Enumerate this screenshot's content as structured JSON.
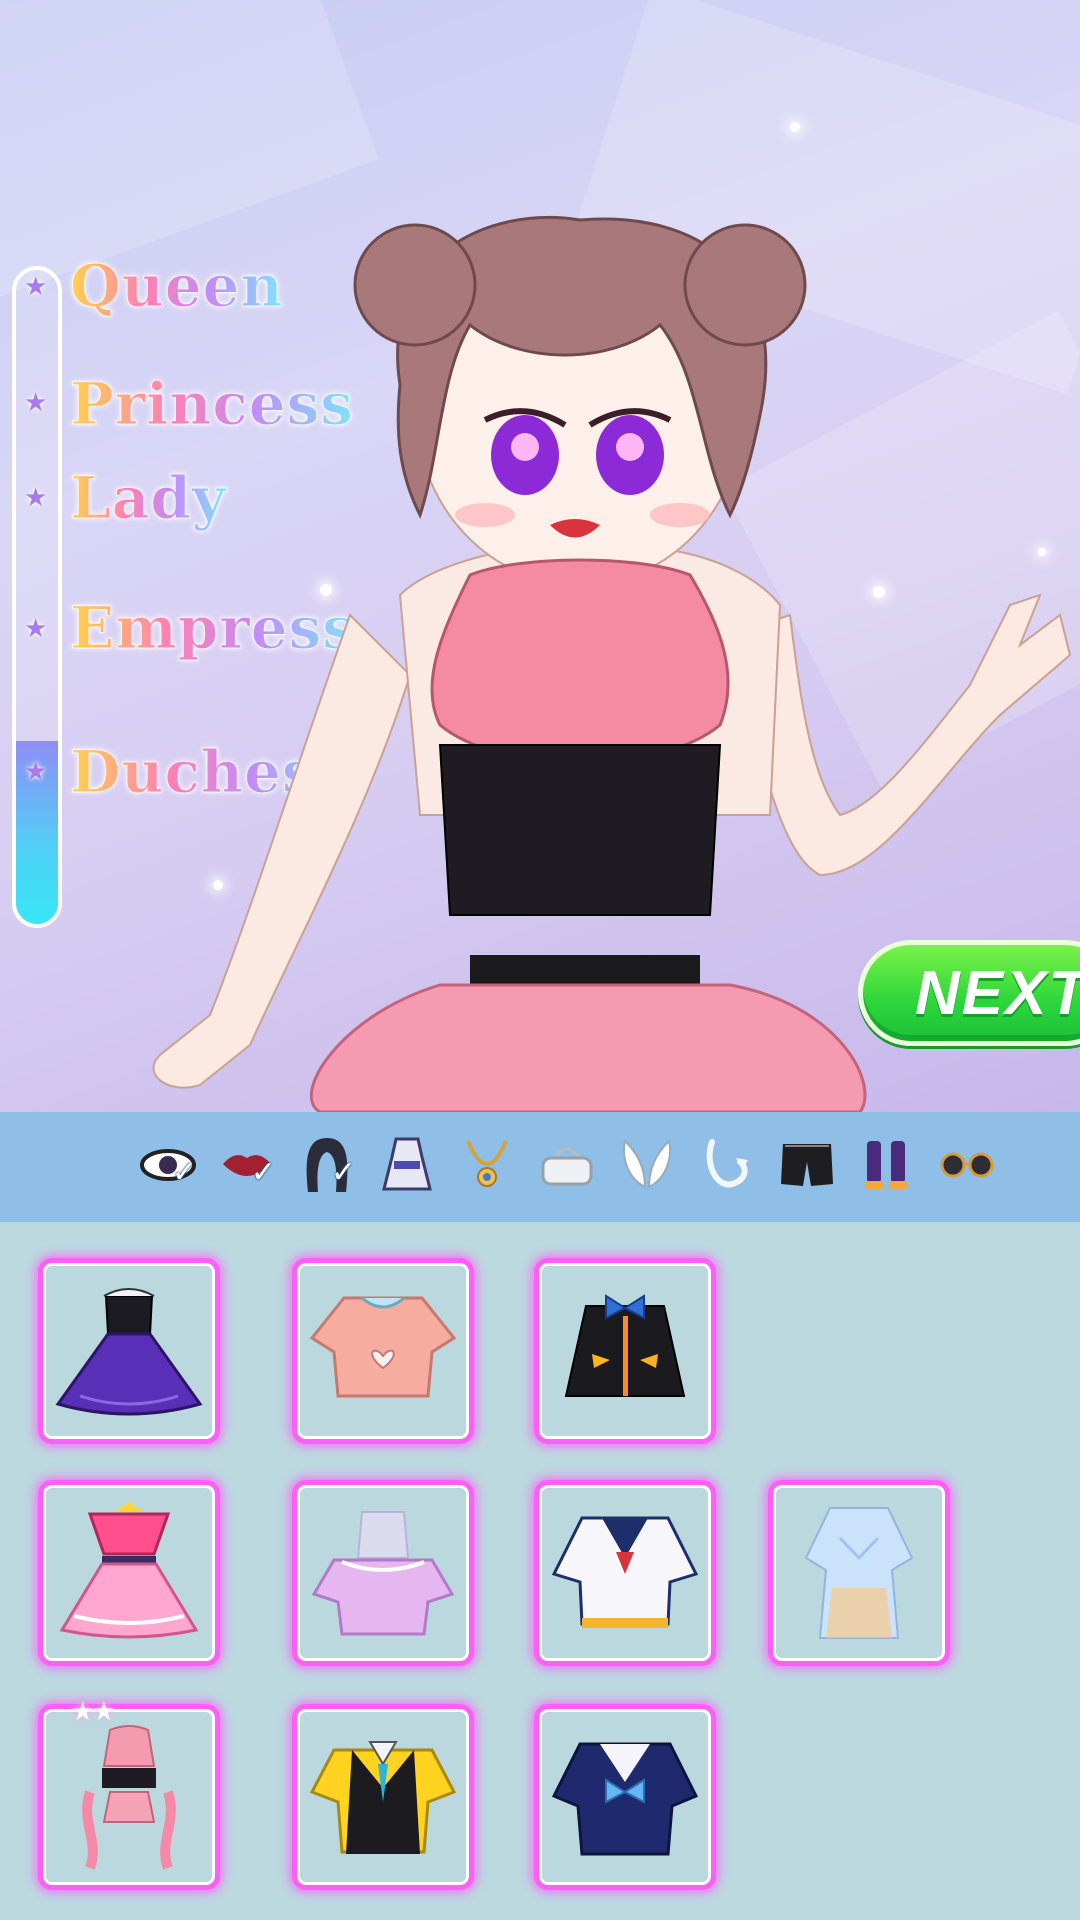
{
  "ranks": [
    {
      "label": "Queen"
    },
    {
      "label": "Princess"
    },
    {
      "label": "Lady"
    },
    {
      "label": "Empress"
    },
    {
      "label": "Duchess"
    }
  ],
  "rank_progress": 0.28,
  "next_button": {
    "label": "NEXT"
  },
  "categories": [
    {
      "icon": "eyes-icon",
      "selected": true
    },
    {
      "icon": "lips-icon",
      "selected": true
    },
    {
      "icon": "hair-icon",
      "selected": true
    },
    {
      "icon": "outfit-icon",
      "selected": false
    },
    {
      "icon": "necklace-icon",
      "selected": false
    },
    {
      "icon": "bag-icon",
      "selected": false
    },
    {
      "icon": "wings-icon",
      "selected": false
    },
    {
      "icon": "tail-icon",
      "selected": false
    },
    {
      "icon": "shorts-icon",
      "selected": false
    },
    {
      "icon": "boots-icon",
      "selected": false
    },
    {
      "icon": "glasses-icon",
      "selected": false
    }
  ],
  "items": [
    {
      "name": "purple-corset-dress"
    },
    {
      "name": "pink-heart-crop-top"
    },
    {
      "name": "black-bow-top"
    },
    {
      "name": "pink-magical-dress"
    },
    {
      "name": "lilac-ruffle-top"
    },
    {
      "name": "sailor-jacket"
    },
    {
      "name": "iridescent-dress"
    },
    {
      "name": "pink-halter-ruffle-outfit",
      "stars": "★★"
    },
    {
      "name": "yellow-vest-shirt"
    },
    {
      "name": "navy-sailor-top"
    }
  ],
  "colors": {
    "slot_border": "#ff5ff7",
    "catbar": "#8fbfe6",
    "grid_bg": "#bcd9e0",
    "next_green": "#2bd63a"
  }
}
